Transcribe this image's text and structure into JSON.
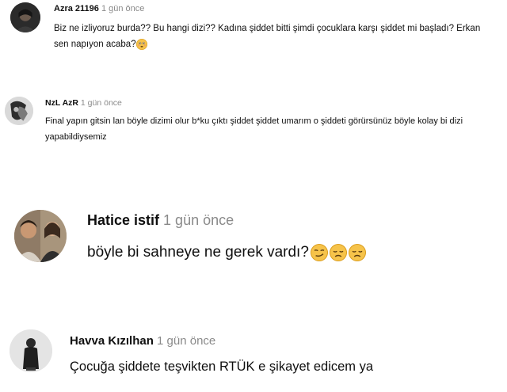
{
  "comments": [
    {
      "author": "Azra 21196",
      "time": "1 gün önce",
      "text": "Biz ne izliyoruz burda?? Bu hangi dizi?? Kadına şiddet bitti şimdi çocuklara karşı şiddet mi başladı? Erkan sen napıyon acaba?",
      "emojis": [
        "flushed-face"
      ]
    },
    {
      "author": "NzL AzR",
      "time": "1 gün önce",
      "text": "Final yapın gitsin lan böyle dizimi olur b*ku çıktı şiddet şiddet umarım o şiddeti görürsünüz böyle kolay bi dizi yapabildiysemiz",
      "emojis": []
    },
    {
      "author": "Hatice istif",
      "time": "1 gün önce",
      "text": "böyle bi sahneye ne gerek vardı?",
      "emojis": [
        "smirking-face",
        "disappointed-face",
        "disappointed-face"
      ]
    },
    {
      "author": "Havva Kızılhan",
      "time": "1 gün önce",
      "text": "Çocuğa şiddete teşvikten RTÜK e şikayet edicem ya",
      "emojis": []
    }
  ],
  "colors": {
    "author": "#0f0f0f",
    "time": "#8a8a8a",
    "emoji": "#f6c34a"
  }
}
